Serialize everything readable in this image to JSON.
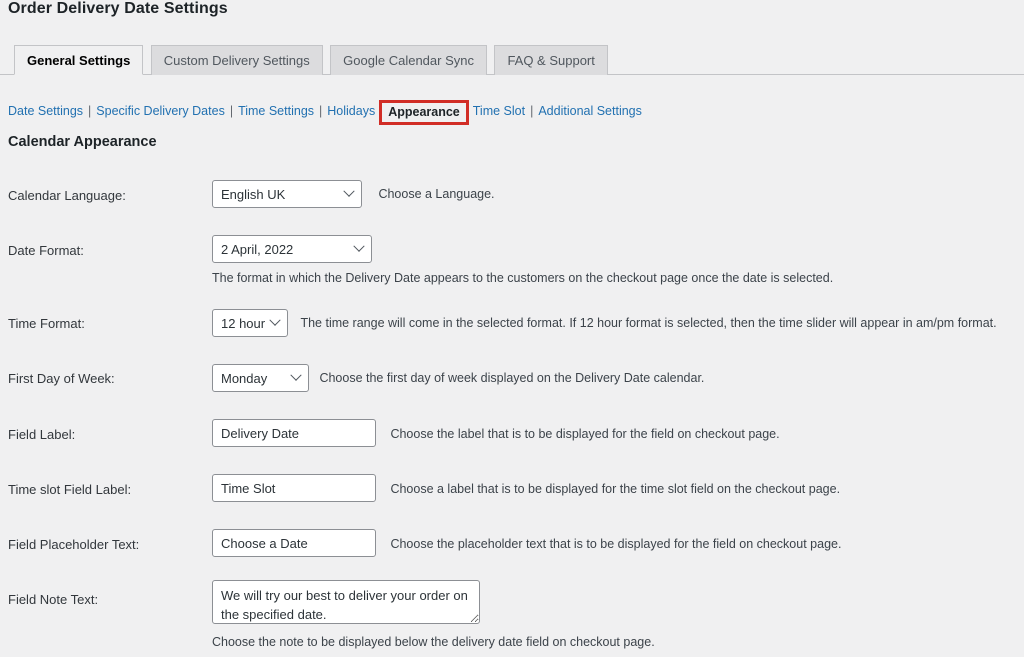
{
  "page": {
    "title": "Order Delivery Date Settings",
    "section_heading": "Calendar Appearance"
  },
  "tabs": [
    {
      "label": "General Settings",
      "active": true
    },
    {
      "label": "Custom Delivery Settings",
      "active": false
    },
    {
      "label": "Google Calendar Sync",
      "active": false
    },
    {
      "label": "FAQ & Support",
      "active": false
    }
  ],
  "subnav": {
    "items": [
      {
        "label": "Date Settings",
        "current": false
      },
      {
        "label": "Specific Delivery Dates",
        "current": false
      },
      {
        "label": "Time Settings",
        "current": false
      },
      {
        "label": "Holidays",
        "current": false
      },
      {
        "label": "Appearance",
        "current": true
      },
      {
        "label": "Time Slot",
        "current": false
      },
      {
        "label": "Additional Settings",
        "current": false
      }
    ],
    "separator": "|",
    "highlight_color": "#d12d26",
    "link_color": "#2271b1"
  },
  "form": {
    "calendar_language": {
      "label": "Calendar Language:",
      "value": "English UK",
      "description": "Choose a Language."
    },
    "date_format": {
      "label": "Date Format:",
      "value": "2 April, 2022",
      "description": "The format in which the Delivery Date appears to the customers on the checkout page once the date is selected."
    },
    "time_format": {
      "label": "Time Format:",
      "value": "12 hour",
      "description": "The time range will come in the selected format. If 12 hour format is selected, then the time slider will appear in am/pm format."
    },
    "first_day_of_week": {
      "label": "First Day of Week:",
      "value": "Monday",
      "description": "Choose the first day of week displayed on the Delivery Date calendar."
    },
    "field_label": {
      "label": "Field Label:",
      "value": "Delivery Date",
      "description": "Choose the label that is to be displayed for the field on checkout page."
    },
    "time_slot_field_label": {
      "label": "Time slot Field Label:",
      "value": "Time Slot",
      "description": "Choose a label that is to be displayed for the time slot field on the checkout page."
    },
    "field_placeholder_text": {
      "label": "Field Placeholder Text:",
      "value": "Choose a Date",
      "description": "Choose the placeholder text that is to be displayed for the field on checkout page."
    },
    "field_note_text": {
      "label": "Field Note Text:",
      "value": "We will try our best to deliver your order on the specified date.",
      "description": "Choose the note to be displayed below the delivery date field on checkout page."
    }
  }
}
